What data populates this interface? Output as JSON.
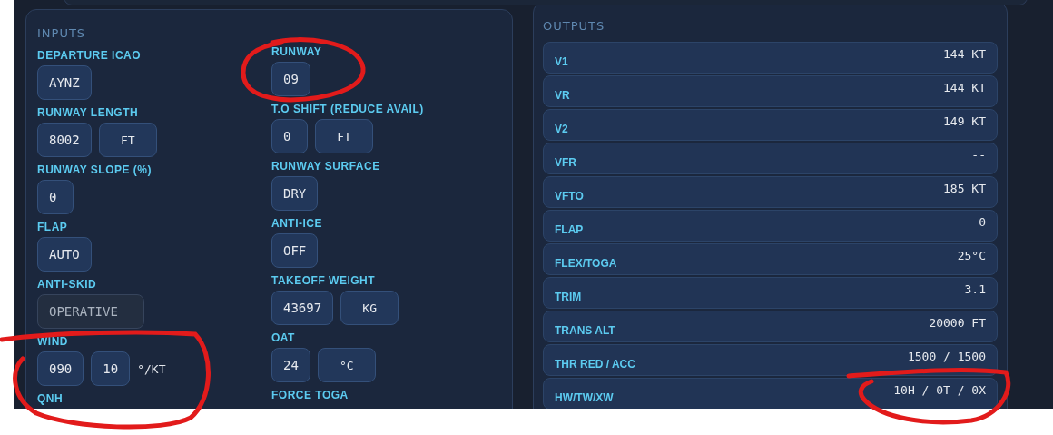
{
  "inputs": {
    "title": "INPUTS",
    "columns": [
      [
        {
          "label": "DEPARTURE ICAO",
          "controls": [
            {
              "kind": "field",
              "value": "AYNZ",
              "disabled": false
            }
          ]
        },
        {
          "label": "RUNWAY LENGTH",
          "controls": [
            {
              "kind": "field",
              "value": "8002",
              "disabled": false
            },
            {
              "kind": "unit",
              "value": "FT"
            }
          ]
        },
        {
          "label": "RUNWAY SLOPE (%)",
          "controls": [
            {
              "kind": "field",
              "value": "0",
              "disabled": false
            }
          ]
        },
        {
          "label": "FLAP",
          "controls": [
            {
              "kind": "field",
              "value": "AUTO",
              "disabled": false
            }
          ]
        },
        {
          "label": "ANTI-SKID",
          "controls": [
            {
              "kind": "field",
              "value": "OPERATIVE",
              "disabled": true
            }
          ]
        },
        {
          "label": "WIND",
          "controls": [
            {
              "kind": "field",
              "value": "090",
              "disabled": false
            },
            {
              "kind": "field",
              "value": "10",
              "disabled": false
            },
            {
              "kind": "suffix",
              "value": "°/KT"
            }
          ]
        },
        {
          "label": "QNH"
        }
      ],
      [
        {
          "label": "RUNWAY",
          "controls": [
            {
              "kind": "field",
              "value": "09",
              "disabled": false
            }
          ]
        },
        {
          "label": "T.O SHIFT (REDUCE AVAIL)",
          "controls": [
            {
              "kind": "field",
              "value": "0",
              "disabled": false
            },
            {
              "kind": "unit",
              "value": "FT"
            }
          ]
        },
        {
          "label": "RUNWAY SURFACE",
          "controls": [
            {
              "kind": "field",
              "value": "DRY",
              "disabled": false
            }
          ]
        },
        {
          "label": "ANTI-ICE",
          "controls": [
            {
              "kind": "field",
              "value": "OFF",
              "disabled": false
            }
          ]
        },
        {
          "label": "TAKEOFF WEIGHT",
          "controls": [
            {
              "kind": "field",
              "value": "43697",
              "disabled": false
            },
            {
              "kind": "unit",
              "value": "KG"
            }
          ]
        },
        {
          "label": "OAT",
          "controls": [
            {
              "kind": "field",
              "value": "24",
              "disabled": false
            },
            {
              "kind": "unit",
              "value": "°C"
            }
          ]
        },
        {
          "label": "FORCE TOGA"
        }
      ]
    ]
  },
  "outputs": {
    "title": "OUTPUTS",
    "rows": [
      {
        "label": "V1",
        "value": "144 KT"
      },
      {
        "label": "VR",
        "value": "144 KT"
      },
      {
        "label": "V2",
        "value": "149 KT"
      },
      {
        "label": "VFR",
        "value": "--"
      },
      {
        "label": "VFTO",
        "value": "185 KT"
      },
      {
        "label": "FLAP",
        "value": "0"
      },
      {
        "label": "FLEX/TOGA",
        "value": "25°C"
      },
      {
        "label": "TRIM",
        "value": "3.1"
      },
      {
        "label": "TRANS ALT",
        "value": "20000 FT"
      },
      {
        "label": "THR RED / ACC",
        "value": "1500 / 1500"
      },
      {
        "label": "HW/TW/XW",
        "value": "10H / 0T / 0X"
      }
    ]
  }
}
